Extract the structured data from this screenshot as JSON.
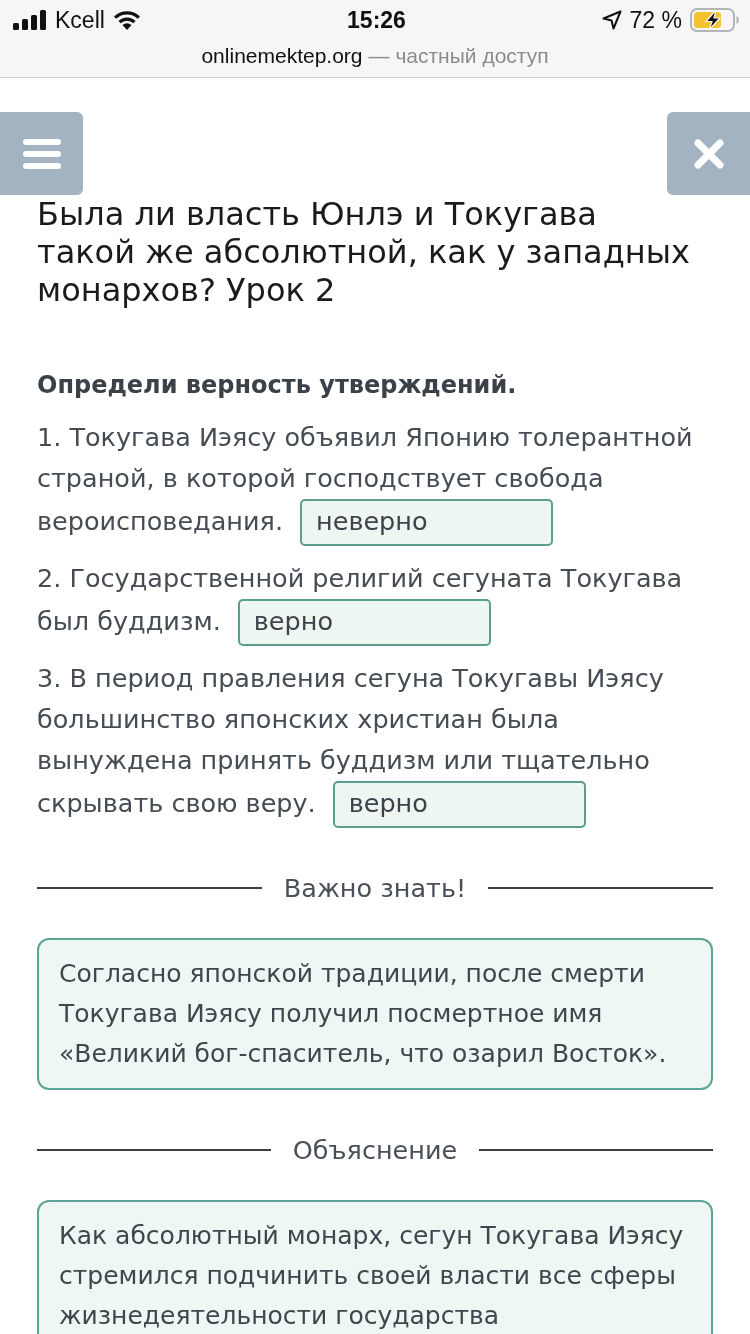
{
  "status_bar": {
    "carrier": "Kcell",
    "time": "15:26",
    "battery": "72 %"
  },
  "address_bar": {
    "domain": "onlinemektep.org",
    "note": "— частный доступ"
  },
  "lesson": {
    "title": "Была ли власть Юнлэ и Токугава такой же абсолютной, как у западных монархов? Урок 2"
  },
  "task": {
    "instruction": "Определи верность утверждений.",
    "statements": [
      {
        "text": "1. Токугава Иэясу объявил Японию толерантной страной, в которой господствует свобода вероисповедания.",
        "answer": "неверно"
      },
      {
        "text": "2. Государственной религий сегуната Токугава был буддизм.",
        "answer": "верно"
      },
      {
        "text": "3. В период правления сегуна Токугавы Иэясу большинство японских христиан была вынуждена принять буддизм или тщательно скрывать свою веру.",
        "answer": "верно"
      }
    ]
  },
  "sections": [
    {
      "heading": "Важно знать!",
      "text": "Согласно японской традиции, после смерти Токугава Иэясу получил посмертное имя «Великий бог-спаситель, что озарил Восток»."
    },
    {
      "heading": "Объяснение",
      "text": "Как абсолютный монарх, сегун Токугава Иэясу стремился подчинить своей власти все сферы жизнедеятельности государства"
    }
  ]
}
